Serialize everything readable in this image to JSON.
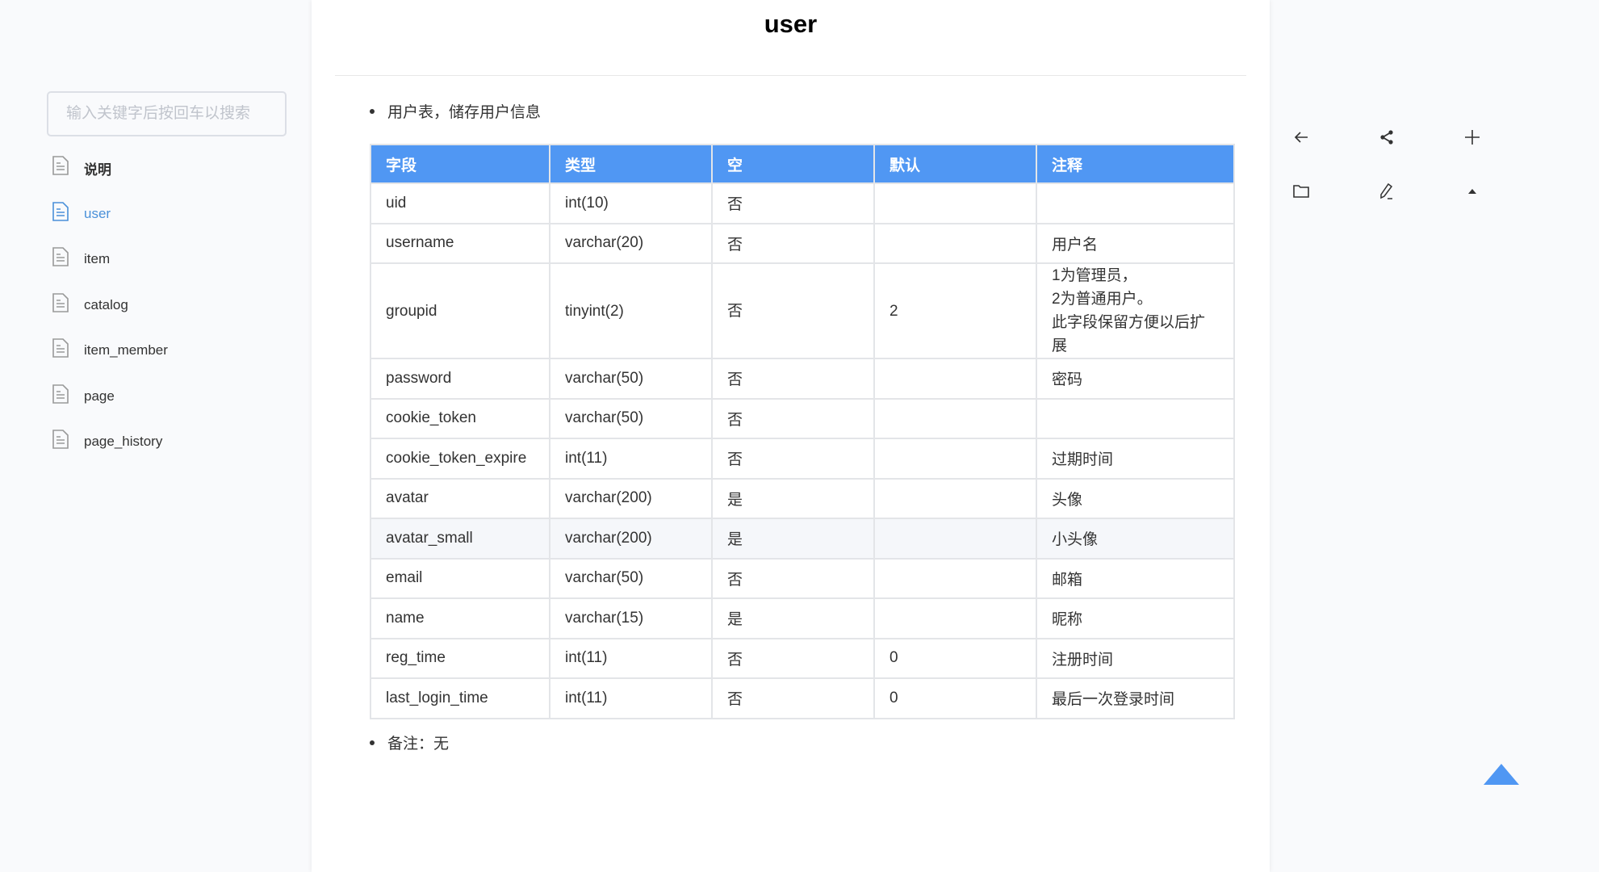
{
  "sidebar": {
    "search_placeholder": "输入关键字后按回车以搜索",
    "items": [
      {
        "label": "说明",
        "icon": "document-icon",
        "active": false
      },
      {
        "label": "user",
        "icon": "document-icon",
        "active": true
      },
      {
        "label": "item",
        "icon": "document-icon",
        "active": false
      },
      {
        "label": "catalog",
        "icon": "document-icon",
        "active": false
      },
      {
        "label": "item_member",
        "icon": "document-icon",
        "active": false
      },
      {
        "label": "page",
        "icon": "document-icon",
        "active": false
      },
      {
        "label": "page_history",
        "icon": "document-icon",
        "active": false
      }
    ]
  },
  "page": {
    "title": "user",
    "description": "用户表，储存用户信息",
    "note": "备注：无"
  },
  "table": {
    "headers": [
      "字段",
      "类型",
      "空",
      "默认",
      "注释"
    ],
    "rows": [
      {
        "field": "uid",
        "type": "int(10)",
        "nullable": "否",
        "default": "",
        "comment": ""
      },
      {
        "field": "username",
        "type": "varchar(20)",
        "nullable": "否",
        "default": "",
        "comment": "用户名"
      },
      {
        "field": "groupid",
        "type": "tinyint(2)",
        "nullable": "否",
        "default": "2",
        "comment": [
          "1为管理员，",
          "2为普通用户。",
          "此字段保留方便以后扩展"
        ]
      },
      {
        "field": "password",
        "type": "varchar(50)",
        "nullable": "否",
        "default": "",
        "comment": "密码"
      },
      {
        "field": "cookie_token",
        "type": "varchar(50)",
        "nullable": "否",
        "default": "",
        "comment": ""
      },
      {
        "field": "cookie_token_expire",
        "type": "int(11)",
        "nullable": "否",
        "default": "",
        "comment": "过期时间"
      },
      {
        "field": "avatar",
        "type": "varchar(200)",
        "nullable": "是",
        "default": "",
        "comment": "头像"
      },
      {
        "field": "avatar_small",
        "type": "varchar(200)",
        "nullable": "是",
        "default": "",
        "comment": "小头像"
      },
      {
        "field": "email",
        "type": "varchar(50)",
        "nullable": "否",
        "default": "",
        "comment": "邮箱"
      },
      {
        "field": "name",
        "type": "varchar(15)",
        "nullable": "是",
        "default": "",
        "comment": "昵称"
      },
      {
        "field": "reg_time",
        "type": "int(11)",
        "nullable": "否",
        "default": "0",
        "comment": "注册时间"
      },
      {
        "field": "last_login_time",
        "type": "int(11)",
        "nullable": "否",
        "default": "0",
        "comment": "最后一次登录时间"
      }
    ]
  },
  "toolbar": {
    "icons": [
      "back-arrow-icon",
      "share-icon",
      "add-icon",
      "folder-icon",
      "edit-icon",
      "collapse-up-icon"
    ]
  },
  "scroll_top": {
    "icon": "scroll-to-top-icon",
    "color": "#5097f3"
  },
  "colors": {
    "accent": "#5097f3",
    "active_link": "#4a90d9"
  }
}
